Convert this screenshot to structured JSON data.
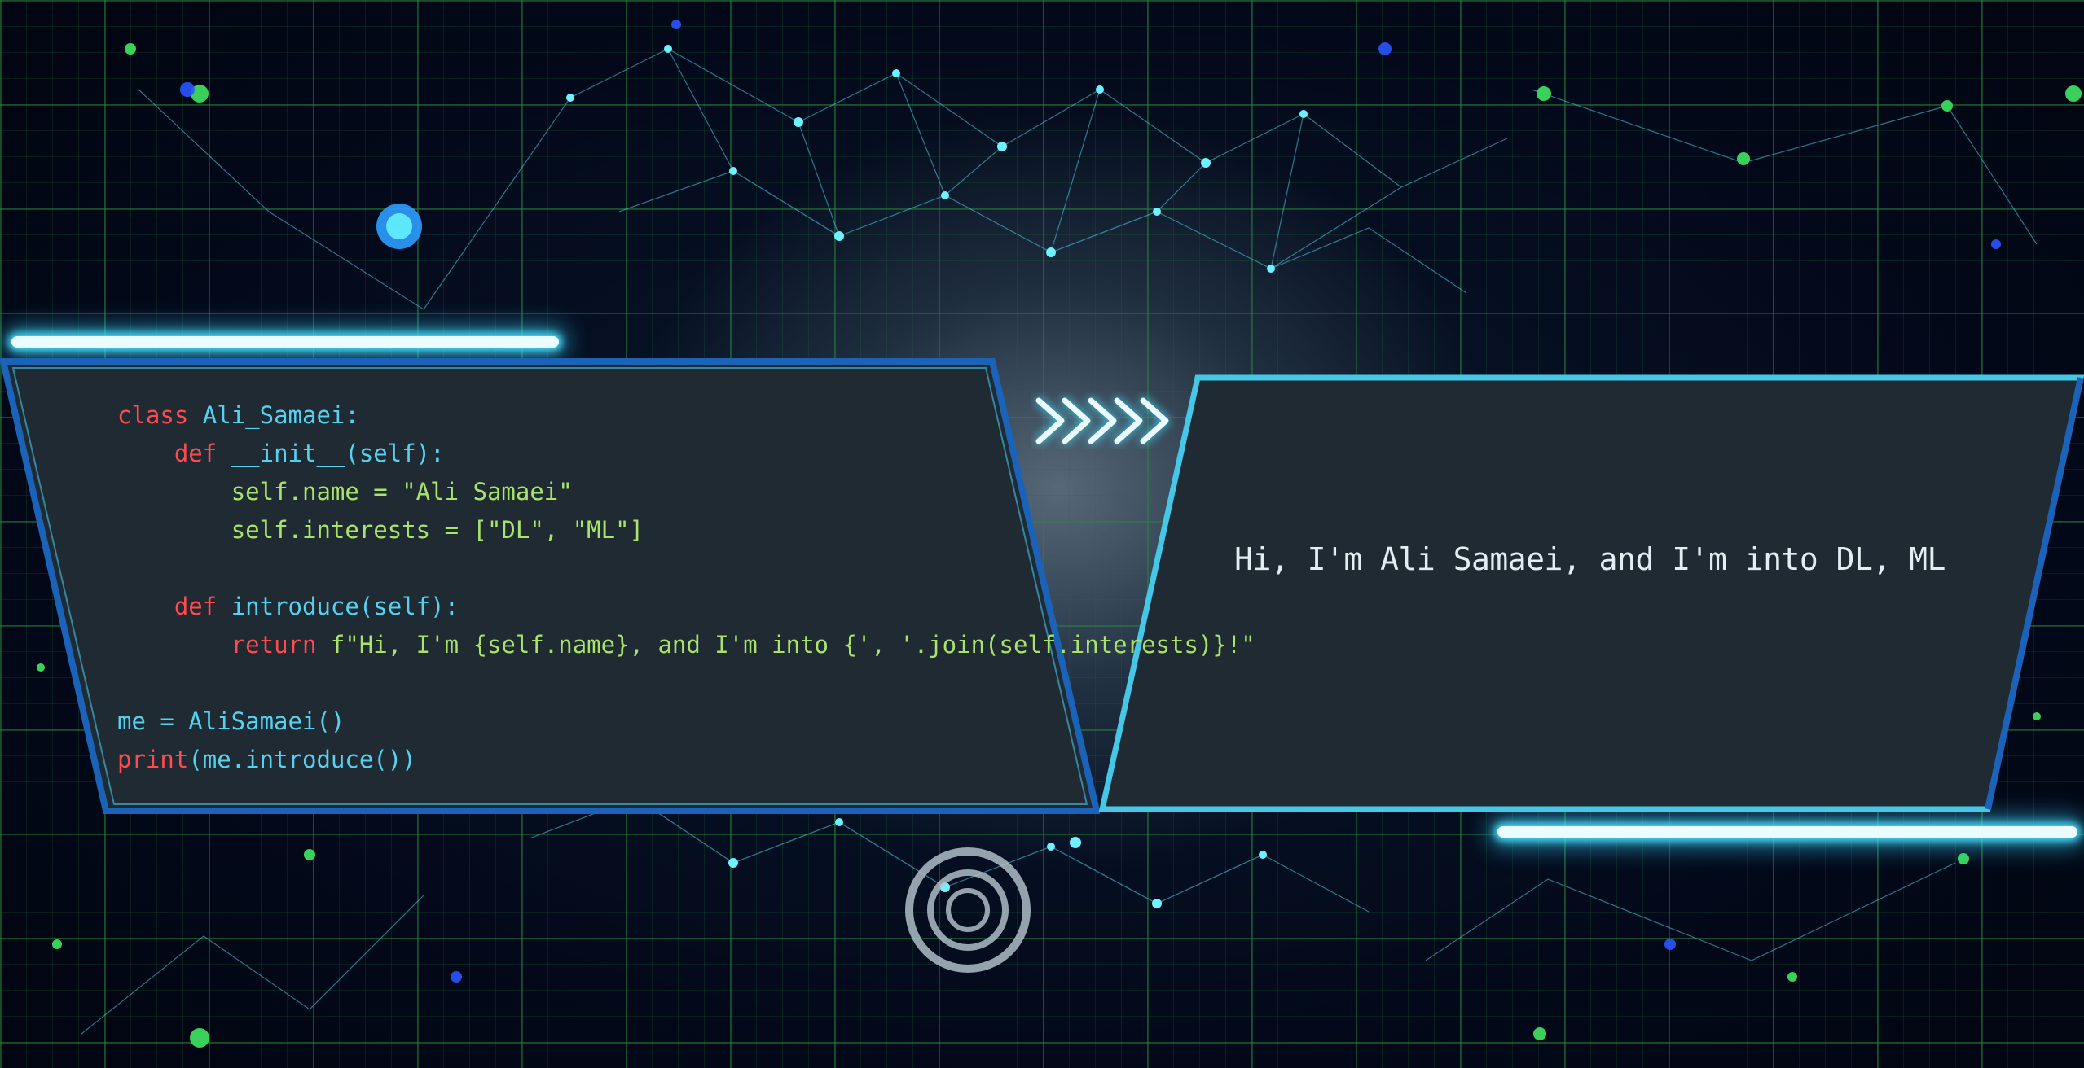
{
  "code": {
    "lines": [
      {
        "indent": "",
        "parts": [
          {
            "t": "class ",
            "k": "kw"
          },
          {
            "t": "Ali_Samaei:",
            "k": "nm"
          }
        ]
      },
      {
        "indent": "    ",
        "parts": [
          {
            "t": "def ",
            "k": "kw"
          },
          {
            "t": "__init__(self):",
            "k": "nm"
          }
        ]
      },
      {
        "indent": "        ",
        "parts": [
          {
            "t": "self.name = \"Ali Samaei\"",
            "k": "st"
          }
        ]
      },
      {
        "indent": "        ",
        "parts": [
          {
            "t": "self.interests = [\"DL\", \"ML\"]",
            "k": "st"
          }
        ]
      },
      {
        "indent": "",
        "parts": []
      },
      {
        "indent": "    ",
        "parts": [
          {
            "t": "def ",
            "k": "kw"
          },
          {
            "t": "introduce(self):",
            "k": "nm"
          }
        ]
      },
      {
        "indent": "        ",
        "parts": [
          {
            "t": "return ",
            "k": "kw"
          },
          {
            "t": "f\"Hi, I'm {self.name}, and I'm into {', '.join(self.interests)}!\"",
            "k": "st"
          }
        ]
      },
      {
        "indent": "",
        "parts": []
      },
      {
        "indent": "",
        "parts": [
          {
            "t": "me = AliSamaei()",
            "k": "nm"
          }
        ]
      },
      {
        "indent": "",
        "parts": [
          {
            "t": "print",
            "k": "kw"
          },
          {
            "t": "(me.introduce())",
            "k": "nm"
          }
        ]
      }
    ]
  },
  "output": {
    "text": "Hi, I'm Ali Samaei, and I'm into DL, ML"
  },
  "colors": {
    "panel_fill": "#1f2a33",
    "panel_border": "#1a63b8",
    "panel_inner_border": "#45c8e8",
    "keyword": "#ff4a4f",
    "name": "#56d1f0",
    "string": "#a9e36b",
    "glow": "#48e2ff",
    "grid": "#2a8c3c"
  },
  "icons": {
    "arrows": "chevron-right-icon"
  }
}
